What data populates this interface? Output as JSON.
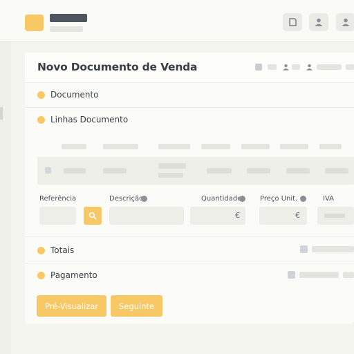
{
  "form": {
    "title": "Novo Documento de Venda",
    "sections": {
      "documento": "Documento",
      "linhas": "Linhas Documento",
      "totais": "Totais",
      "pagamento": "Pagamento"
    },
    "fields": {
      "referencia": "Referência",
      "descricao": "Descrição",
      "quantidade": "Quantidade",
      "preco": "Preço Unit.",
      "iva": "IVA",
      "quantidade_unit": "€",
      "preco_unit": "€"
    },
    "buttons": {
      "preview": "Pré-Visualizar",
      "next": "Seguinte"
    }
  },
  "icons": {
    "header_buttons": [
      "document-icon",
      "user-icon",
      "user-icon"
    ],
    "search": "search-icon"
  },
  "colors": {
    "accent": "#f8c866",
    "text": "#3a3f47",
    "background": "#f5f5f0"
  }
}
